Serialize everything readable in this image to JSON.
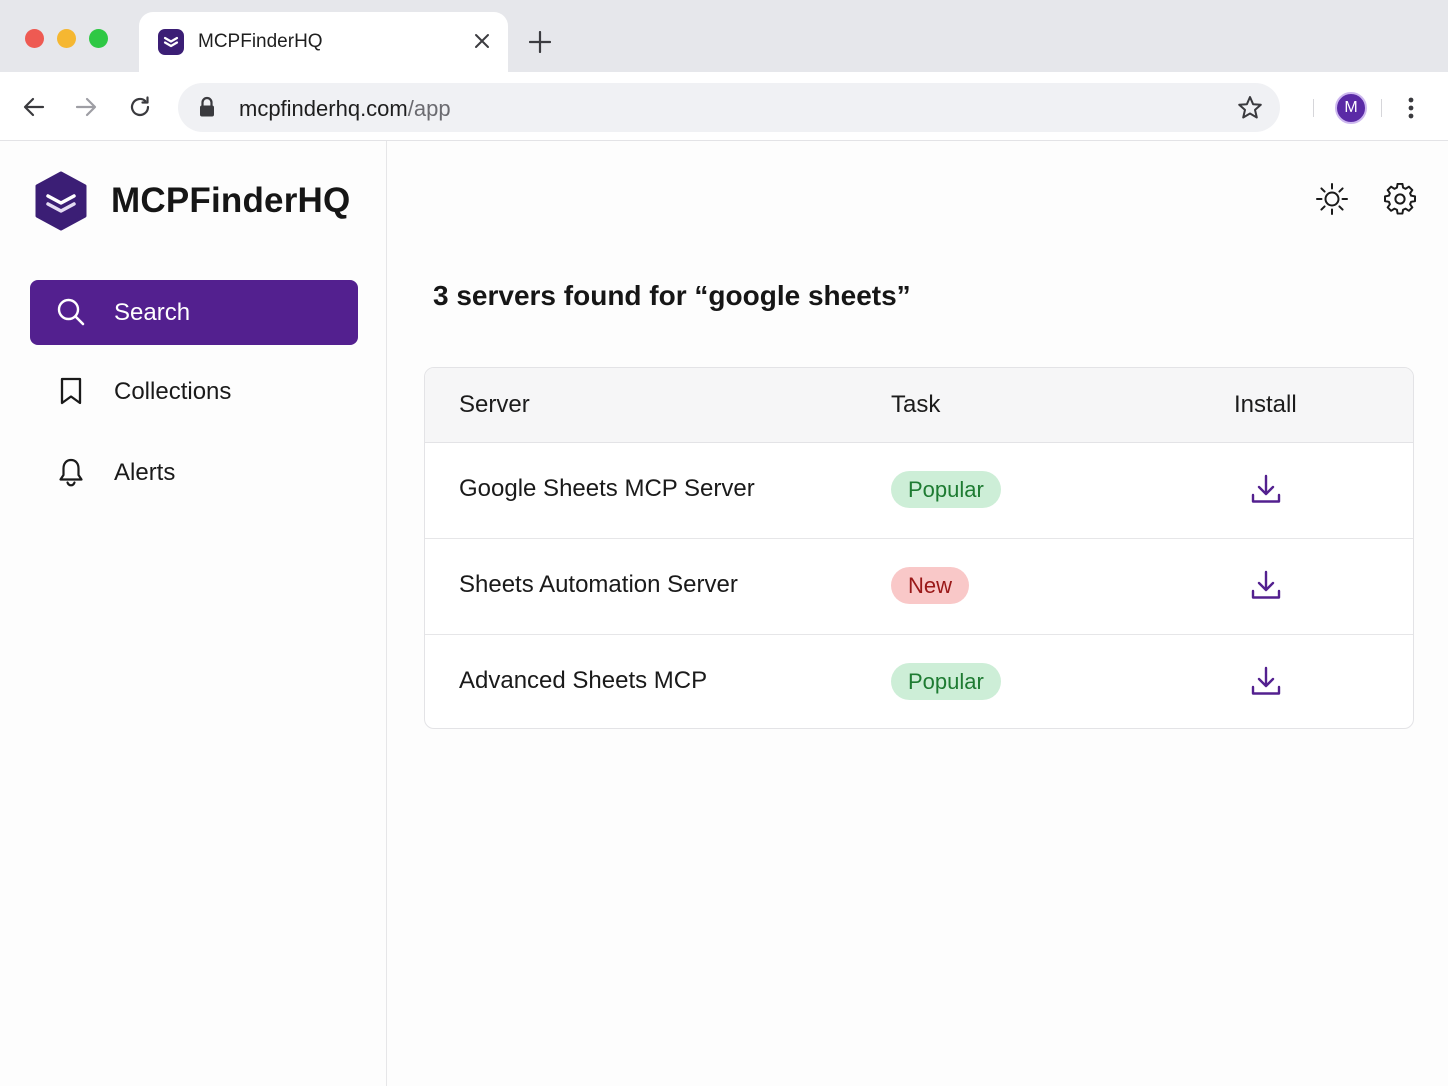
{
  "browser": {
    "tab": {
      "title": "MCPFinderHQ",
      "favicon": "shield-icon"
    },
    "new_tab_icon": "plus-icon",
    "url_host": "mcpfinderhq.com",
    "url_path": "/app",
    "profile_initial": "M",
    "nav_icons": [
      "arrow-left-icon",
      "arrow-right-icon",
      "reload-icon"
    ]
  },
  "app": {
    "brand": "MCPFinderHQ",
    "accent": "#53208f",
    "sidebar": {
      "items": [
        {
          "label": "Search",
          "icon": "search-icon",
          "active": true
        },
        {
          "label": "Collections",
          "icon": "bookmark-icon",
          "active": false
        },
        {
          "label": "Alerts",
          "icon": "bell-icon",
          "active": false
        }
      ]
    },
    "header_actions": [
      "sun-icon",
      "gear-icon"
    ],
    "results": {
      "heading": "3 servers found for “google sheets”",
      "columns": [
        "Server",
        "Task",
        "Install"
      ],
      "rows": [
        {
          "server": "Google Sheets MCP Server",
          "task": "Popular",
          "task_color": "#1e7b32"
        },
        {
          "server": "Sheets Automation Server",
          "task": "New",
          "task_color": "#9a1818"
        },
        {
          "server": "Advanced Sheets MCP",
          "task": "Popular",
          "task_color": "#1e7b32"
        }
      ]
    }
  }
}
